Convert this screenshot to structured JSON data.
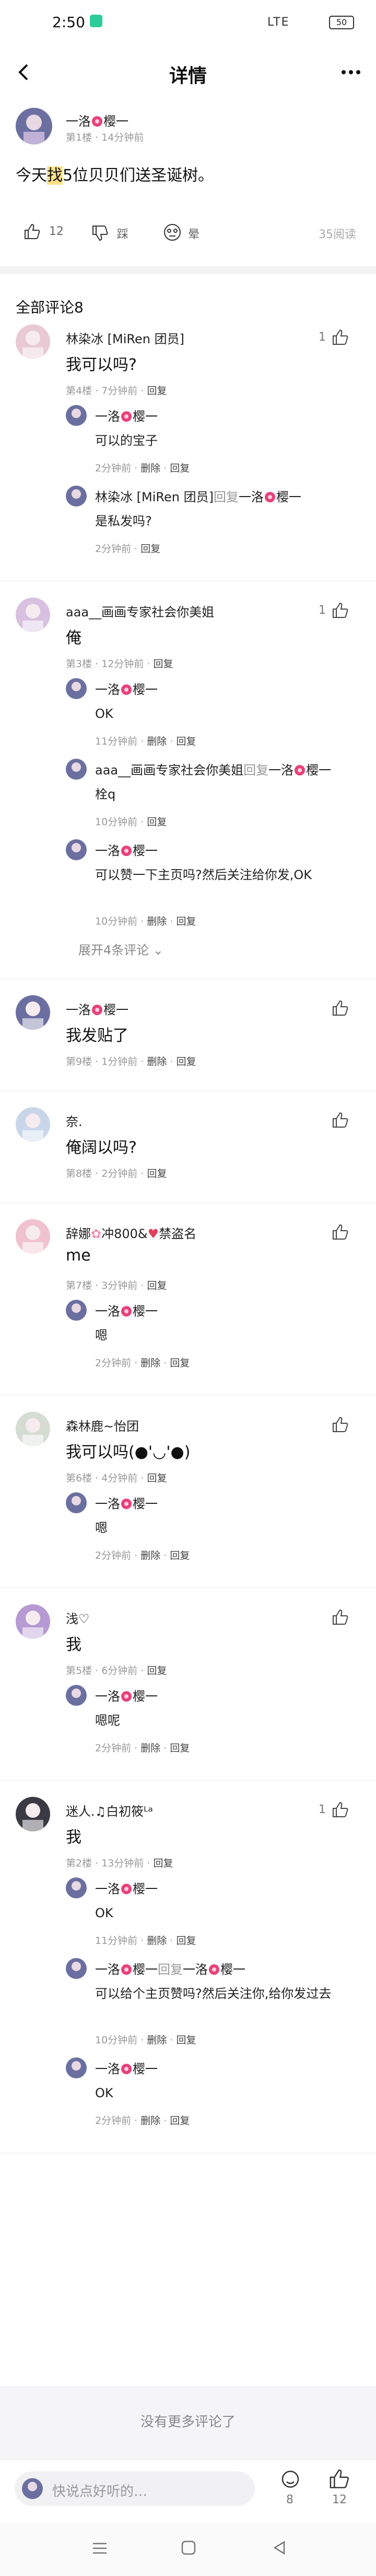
{
  "status": {
    "time": "2:50",
    "battery": "50",
    "network": "LTE"
  },
  "topbar": {
    "title": "详情"
  },
  "post": {
    "author": "一洛",
    "author_suffix": "樱一",
    "floor": "第1楼",
    "time": "14分钟前",
    "content_pre": "今天",
    "content_hl": "找",
    "content_post": "5位贝贝们送圣诞树。",
    "like_count": "12",
    "dislike_label": "踩",
    "meh_label": "晕",
    "views": "35阅读"
  },
  "comments_header": "全部评论8",
  "comments": [
    {
      "name": "林染冰 [MiRen 团员]",
      "floor": "第4楼",
      "time": "7分钟前",
      "action": "回复",
      "content": "我可以吗?",
      "likes": "1",
      "replies": [
        {
          "name": "一洛",
          "suffix": "樱一",
          "text": "可以的宝子",
          "time": "2分钟前",
          "extra": "删除",
          "action": "回复"
        },
        {
          "name": "林染冰 [MiRen 团员]",
          "reply_to": "回复",
          "target": "一洛",
          "target_suffix": "樱一",
          "text": "是私发吗?",
          "time": "2分钟前",
          "action": "回复"
        }
      ]
    },
    {
      "name": "aaa__画画专家社会你美姐",
      "floor": "第3楼",
      "time": "12分钟前",
      "action": "回复",
      "content": "俺",
      "likes": "1",
      "replies": [
        {
          "name": "一洛",
          "suffix": "樱一",
          "text": "OK",
          "time": "11分钟前",
          "extra": "删除",
          "action": "回复"
        },
        {
          "name": "aaa__画画专家社会你美姐",
          "reply_to": "回复",
          "target": "一洛",
          "target_suffix": "樱一",
          "text": "栓q",
          "time": "10分钟前",
          "action": "回复"
        },
        {
          "name": "一洛",
          "suffix": "樱一",
          "text": "可以赞一下主页吗?然后关注给你发,OK",
          "time": "10分钟前",
          "extra": "删除",
          "action": "回复"
        }
      ],
      "expand": "展开4条评论"
    },
    {
      "name": "一洛",
      "suffix": "樱一",
      "floor": "第9楼",
      "time": "1分钟前",
      "extra": "删除",
      "action": "回复",
      "content": "我发贴了"
    },
    {
      "name": "奈.",
      "floor": "第8楼",
      "time": "2分钟前",
      "action": "回复",
      "content": "俺阔以吗?"
    },
    {
      "name": "辞娜",
      "name_mid": "冲800&",
      "name_end": "禁盗名",
      "floor": "第7楼",
      "time": "3分钟前",
      "action": "回复",
      "content": "me",
      "replies": [
        {
          "name": "一洛",
          "suffix": "樱一",
          "text": "嗯",
          "time": "2分钟前",
          "extra": "删除",
          "action": "回复"
        }
      ]
    },
    {
      "name": "森林鹿~怡团",
      "floor": "第6楼",
      "time": "4分钟前",
      "action": "回复",
      "content": "我可以吗(●'◡'●)",
      "replies": [
        {
          "name": "一洛",
          "suffix": "樱一",
          "text": "嗯",
          "time": "2分钟前",
          "extra": "删除",
          "action": "回复"
        }
      ]
    },
    {
      "name": "浅♡",
      "floor": "第5楼",
      "time": "6分钟前",
      "action": "回复",
      "content": "我",
      "replies": [
        {
          "name": "一洛",
          "suffix": "樱一",
          "text": "嗯呢",
          "time": "2分钟前",
          "extra": "删除",
          "action": "回复"
        }
      ]
    },
    {
      "name": "迷人.♫白初筱ᴸᵃ",
      "floor": "第2楼",
      "time": "13分钟前",
      "action": "回复",
      "content": "我",
      "likes": "1",
      "replies": [
        {
          "name": "一洛",
          "suffix": "樱一",
          "text": "OK",
          "time": "11分钟前",
          "extra": "删除",
          "action": "回复"
        },
        {
          "name": "一洛",
          "suffix": "樱一",
          "reply_to": "回复",
          "target": "一洛",
          "target_suffix": "樱一",
          "text": "可以给个主页赞吗?然后关注你,给你发过去",
          "time": "10分钟前",
          "extra": "删除",
          "action": "回复"
        },
        {
          "name": "一洛",
          "suffix": "樱一",
          "text": "OK",
          "time": "2分钟前",
          "extra": "删除",
          "action": "回复"
        }
      ]
    }
  ],
  "footer_note": "没有更多评论了",
  "bottom": {
    "placeholder": "快说点好听的…",
    "comment_count": "8",
    "like_count": "12"
  }
}
